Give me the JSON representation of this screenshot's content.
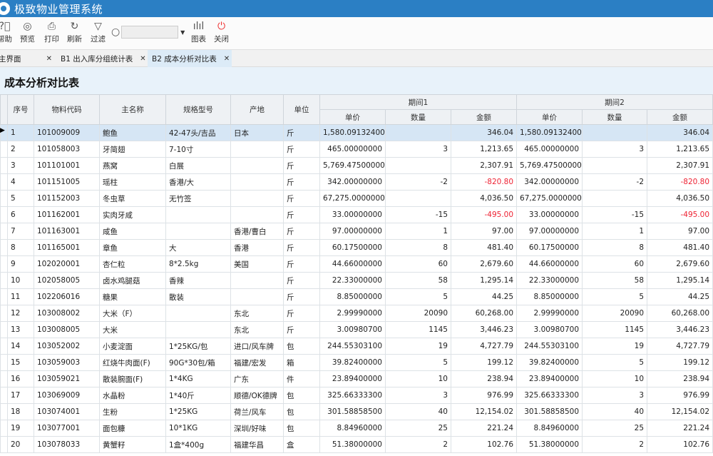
{
  "app": {
    "title": "极致物业管理系统"
  },
  "toolbar": {
    "help": "帮助",
    "preview": "预览",
    "print": "打印",
    "refresh": "刷新",
    "filter": "过滤",
    "search_value": "",
    "chart": "图表",
    "close": "关闭"
  },
  "tabs": [
    {
      "label": "主界面",
      "active": false
    },
    {
      "label": "B1 出入库分组统计表",
      "active": false
    },
    {
      "label": "B2 成本分析对比表",
      "active": true
    }
  ],
  "report": {
    "title": "成本分析对比表"
  },
  "table": {
    "headers": {
      "seq": "序号",
      "code": "物料代码",
      "name": "主名称",
      "spec": "规格型号",
      "origin": "产地",
      "unit": "单位",
      "period1": "期间1",
      "period2": "期间2",
      "price": "单价",
      "qty": "数量",
      "amount": "金额"
    },
    "rows": [
      {
        "seq": "1",
        "code": "101009009",
        "name": "鲍鱼",
        "spec": "42-47头/吉品",
        "origin": "日本",
        "unit": "斤",
        "p1_price": "1,580.09132400",
        "p1_qty": "",
        "p1_amt": "346.04",
        "p2_price": "1,580.09132400",
        "p2_qty": "",
        "p2_amt": "346.04"
      },
      {
        "seq": "2",
        "code": "101058003",
        "name": "牙简翅",
        "spec": "7-10寸",
        "origin": "",
        "unit": "斤",
        "p1_price": "465.00000000",
        "p1_qty": "3",
        "p1_amt": "1,213.65",
        "p2_price": "465.00000000",
        "p2_qty": "3",
        "p2_amt": "1,213.65"
      },
      {
        "seq": "3",
        "code": "101101001",
        "name": "燕窝",
        "spec": "白展",
        "origin": "",
        "unit": "斤",
        "p1_price": "5,769.47500000",
        "p1_qty": "",
        "p1_amt": "2,307.91",
        "p2_price": "5,769.47500000",
        "p2_qty": "",
        "p2_amt": "2,307.91"
      },
      {
        "seq": "4",
        "code": "101151005",
        "name": "瑶柱",
        "spec": "香港/大",
        "origin": "",
        "unit": "斤",
        "p1_price": "342.00000000",
        "p1_qty": "-2",
        "p1_amt": "-820.80",
        "p2_price": "342.00000000",
        "p2_qty": "-2",
        "p2_amt": "-820.80"
      },
      {
        "seq": "5",
        "code": "101152003",
        "name": "冬虫草",
        "spec": "无竹签",
        "origin": "",
        "unit": "斤",
        "p1_price": "67,275.00000000",
        "p1_qty": "",
        "p1_amt": "4,036.50",
        "p2_price": "67,275.00000000",
        "p2_qty": "",
        "p2_amt": "4,036.50"
      },
      {
        "seq": "6",
        "code": "101162001",
        "name": "实肉牙咸",
        "spec": "",
        "origin": "",
        "unit": "斤",
        "p1_price": "33.00000000",
        "p1_qty": "-15",
        "p1_amt": "-495.00",
        "p2_price": "33.00000000",
        "p2_qty": "-15",
        "p2_amt": "-495.00"
      },
      {
        "seq": "7",
        "code": "101163001",
        "name": "咸鱼",
        "spec": "",
        "origin": "香港/曹白",
        "unit": "斤",
        "p1_price": "97.00000000",
        "p1_qty": "1",
        "p1_amt": "97.00",
        "p2_price": "97.00000000",
        "p2_qty": "1",
        "p2_amt": "97.00"
      },
      {
        "seq": "8",
        "code": "101165001",
        "name": "章鱼",
        "spec": "大",
        "origin": "香港",
        "unit": "斤",
        "p1_price": "60.17500000",
        "p1_qty": "8",
        "p1_amt": "481.40",
        "p2_price": "60.17500000",
        "p2_qty": "8",
        "p2_amt": "481.40"
      },
      {
        "seq": "9",
        "code": "102020001",
        "name": "杏仁粒",
        "spec": "8*2.5kg",
        "origin": "美国",
        "unit": "斤",
        "p1_price": "44.66000000",
        "p1_qty": "60",
        "p1_amt": "2,679.60",
        "p2_price": "44.66000000",
        "p2_qty": "60",
        "p2_amt": "2,679.60"
      },
      {
        "seq": "10",
        "code": "102058005",
        "name": "卤水鸡腿菇",
        "spec": "香辣",
        "origin": "",
        "unit": "斤",
        "p1_price": "22.33000000",
        "p1_qty": "58",
        "p1_amt": "1,295.14",
        "p2_price": "22.33000000",
        "p2_qty": "58",
        "p2_amt": "1,295.14"
      },
      {
        "seq": "11",
        "code": "102206016",
        "name": "糖果",
        "spec": "散装",
        "origin": "",
        "unit": "斤",
        "p1_price": "8.85000000",
        "p1_qty": "5",
        "p1_amt": "44.25",
        "p2_price": "8.85000000",
        "p2_qty": "5",
        "p2_amt": "44.25"
      },
      {
        "seq": "12",
        "code": "103008002",
        "name": "大米（F）",
        "spec": "",
        "origin": "东北",
        "unit": "斤",
        "p1_price": "2.99990000",
        "p1_qty": "20090",
        "p1_amt": "60,268.00",
        "p2_price": "2.99990000",
        "p2_qty": "20090",
        "p2_amt": "60,268.00"
      },
      {
        "seq": "13",
        "code": "103008005",
        "name": "大米",
        "spec": "",
        "origin": "东北",
        "unit": "斤",
        "p1_price": "3.00980700",
        "p1_qty": "1145",
        "p1_amt": "3,446.23",
        "p2_price": "3.00980700",
        "p2_qty": "1145",
        "p2_amt": "3,446.23"
      },
      {
        "seq": "14",
        "code": "103052002",
        "name": "小麦淀面",
        "spec": "1*25KG/包",
        "origin": "进口/风车牌",
        "unit": "包",
        "p1_price": "244.55303100",
        "p1_qty": "19",
        "p1_amt": "4,727.79",
        "p2_price": "244.55303100",
        "p2_qty": "19",
        "p2_amt": "4,727.79"
      },
      {
        "seq": "15",
        "code": "103059003",
        "name": "红烧牛肉面(F)",
        "spec": "90G*30包/箱",
        "origin": "福建/宏发",
        "unit": "箱",
        "p1_price": "39.82400000",
        "p1_qty": "5",
        "p1_amt": "199.12",
        "p2_price": "39.82400000",
        "p2_qty": "5",
        "p2_amt": "199.12"
      },
      {
        "seq": "16",
        "code": "103059021",
        "name": "散装腕面(F)",
        "spec": "1*4KG",
        "origin": "广东",
        "unit": "件",
        "p1_price": "23.89400000",
        "p1_qty": "10",
        "p1_amt": "238.94",
        "p2_price": "23.89400000",
        "p2_qty": "10",
        "p2_amt": "238.94"
      },
      {
        "seq": "17",
        "code": "103069009",
        "name": "水晶粉",
        "spec": "1*40斤",
        "origin": "顺德/OK德牌",
        "unit": "包",
        "p1_price": "325.66333300",
        "p1_qty": "3",
        "p1_amt": "976.99",
        "p2_price": "325.66333300",
        "p2_qty": "3",
        "p2_amt": "976.99"
      },
      {
        "seq": "18",
        "code": "103074001",
        "name": "生粉",
        "spec": "1*25KG",
        "origin": "荷兰/风车",
        "unit": "包",
        "p1_price": "301.58858500",
        "p1_qty": "40",
        "p1_amt": "12,154.02",
        "p2_price": "301.58858500",
        "p2_qty": "40",
        "p2_amt": "12,154.02"
      },
      {
        "seq": "19",
        "code": "103077001",
        "name": "面包糠",
        "spec": "10*1KG",
        "origin": "深圳/好味",
        "unit": "包",
        "p1_price": "8.84960000",
        "p1_qty": "25",
        "p1_amt": "221.24",
        "p2_price": "8.84960000",
        "p2_qty": "25",
        "p2_amt": "221.24"
      },
      {
        "seq": "20",
        "code": "103078033",
        "name": "黄蟹籽",
        "spec": "1盒*400g",
        "origin": "福建华昌",
        "unit": "盒",
        "p1_price": "51.38000000",
        "p1_qty": "2",
        "p1_amt": "102.76",
        "p2_price": "51.38000000",
        "p2_qty": "2",
        "p2_amt": "102.76"
      }
    ]
  }
}
